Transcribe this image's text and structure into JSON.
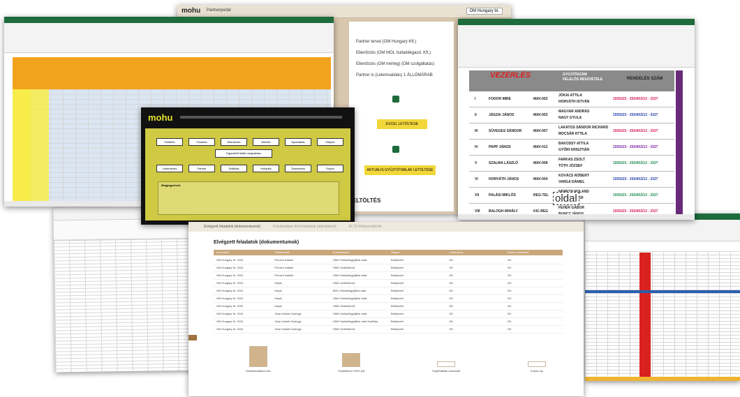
{
  "portal": {
    "logo": "mohu",
    "title": "Partnerportál",
    "user_chip": "OM Hungary bt.",
    "side_list": [
      "Partner tervei (OM Hungary Kft.)",
      "Ellenőrzés (OM MOL hulladékgazd. Kft.)",
      "Ellenőrzés (OM mérleg) (OM szolgáltatás)",
      "Partner is (Lelemvalidás) 1 ÁLLÓMÁRAB"
    ],
    "btn1": "EXCEL LETÖLTÉSE",
    "btn2": "AKTUÁLIS GYŰJTŐTÁBLÁK LETÖLTÉSE",
    "upload_label": "FELTÖLTÉS"
  },
  "excel_right": {
    "title": "VEZÉRLÉS",
    "col_header": "GYŰJTŐSZÁM",
    "col_header2": "FELELŐS RÉSZVÉTELE",
    "col_header3": "RENDELÉS SZÁM",
    "rows": [
      {
        "n": "I",
        "name": "FODOR IMRE",
        "code": "MAV-002",
        "p1": "JÓKAI ATTILA",
        "p2": "HORVÁTH ISTVÁN",
        "ord": "1930223 - 2024/02/13 - 3327",
        "color": "#d4145a"
      },
      {
        "n": "II",
        "name": "JÁSZAI JÁNOS",
        "code": "MAV-003",
        "p1": "MAGYAR ANDRÁS",
        "p2": "NAGY GYULA",
        "ord": "1930223 - 2024/02/13 - 3327",
        "color": "#1f3ba8"
      },
      {
        "n": "III",
        "name": "SÜVEGES SÁNDOR",
        "code": "MAV-007",
        "p1": "LAKATOS SÁNDOR RICHÁRD",
        "p2": "MOCSÁR ATTILA",
        "ord": "1930223 - 2024/02/13 - 3327",
        "color": "#d4145a"
      },
      {
        "n": "IV",
        "name": "PAPP JÁNOS",
        "code": "MAV-012",
        "p1": "BAKOSSY ATTILA",
        "p2": "GYŐRI KRISZTIÁN",
        "ord": "1930223 - 2024/02/13 - 3327",
        "color": "#7a1fa8"
      },
      {
        "n": "V",
        "name": "SZALMA LÁSZLÓ",
        "code": "MAV-008",
        "p1": "FARKAS ZSOLT",
        "p2": "TÓTH JÓZSEF",
        "ord": "1930223 - 2024/02/13 - 3327",
        "color": "#178a4a"
      },
      {
        "n": "VI",
        "name": "HORVÁTH JÁNOS",
        "code": "MAV-004",
        "p1": "KOVÁCS RÓBERT",
        "p2": "VARGA DÁNIEL",
        "ord": "1930223 - 2024/02/13 - 3327",
        "color": "#1f3ba8"
      },
      {
        "n": "VII",
        "name": "PALÁSI MIKLÓS",
        "code": "REG-TEL",
        "p1": "NÉMETH ROLAND",
        "p2": "SZABÓ PÉTER",
        "ord": "1930223 - 2024/02/13 - 3327",
        "color": "#178a4a"
      },
      {
        "n": "VIII",
        "name": "BALOGH MIHÁLY",
        "code": "KIC-REG",
        "p1": "FEHÉR GÁBOR",
        "p2": "BUNCZ JÁNOS",
        "ord": "1930223 - 2024/02/13 - 3327",
        "color": "#d4145a"
      }
    ],
    "page_label": "oldal"
  },
  "mohu_dialog": {
    "logo": "mohu",
    "buttons_row1": [
      "Feltöltés",
      "Frissítés",
      "Ellenőrzés",
      "Mentés",
      "Nyomtatás",
      "Kilépés"
    ],
    "mid_label": "Egyesített listák megnyitása",
    "buttons_row2": [
      "Lekérdezés",
      "Partner",
      "Szállítás",
      "Hulladék",
      "Összesítés",
      "Export"
    ],
    "notes_title": "Megjegyzések:"
  },
  "tasks": {
    "tabs": [
      "Elvégzett feladatok (dokumentumok)",
      "Folyamatban lévő feladatok (aktiválások)",
      "ELTE felhasználói fel"
    ],
    "heading": "Elvégzett feladatok (dokumentumok)",
    "columns": [
      "Azonosító",
      "Felhasználó",
      "Dokumentum",
      "Állapot",
      "Létrehozva",
      "Utolsó módosítás"
    ],
    "rows": [
      [
        "OM Hungary bt. 2024",
        "Pénzes Katalin",
        "OMD Hulladékgyűjtési adat",
        "Befejezett",
        "OK",
        "OK"
      ],
      [
        "OM Hungary bt. 2024",
        "Pénzes Katalin",
        "OMD Szállítólevél",
        "Befejezett",
        "OK",
        "OK"
      ],
      [
        "OM Hungary bt. 2024",
        "Pénzes Katalin",
        "OMD Hulladékgyűjtési adat",
        "Befejezett",
        "OK",
        "OK"
      ],
      [
        "OM Hungary bt. 2024",
        "Hajdú",
        "OMD Szállítólevél",
        "Befejezett",
        "OK",
        "OK"
      ],
      [
        "OM Hungary bt. 2024",
        "Hajdú",
        "MOL Hulladékgyűjtési adat",
        "Befejezett",
        "OK",
        "OK"
      ],
      [
        "OM Hungary bt. 2024",
        "Hajdú",
        "OMD Hulladékgyűjtési adat",
        "Befejezett",
        "OK",
        "OK"
      ],
      [
        "OM Hungary bt. 2024",
        "Hajdú",
        "OMD Szállítólevél",
        "Befejezett",
        "OK",
        "OK"
      ],
      [
        "OM Hungary bt. 2024",
        "Szép Katalin Gyöngyi",
        "OMD Hulladékgyűjtési adat",
        "Befejezett",
        "OK",
        "OK"
      ],
      [
        "OM Hungary bt. 2024",
        "Szép Katalin Gyöngyi",
        "OMD Hulladékgyűjtési adat Szállítás",
        "Befejezett",
        "OK",
        "OK"
      ],
      [
        "OM Hungary bt. 2024",
        "Szép Katalin Gyöngyi",
        "OMD Szállítólevél",
        "Befejezett",
        "OK",
        "OK"
      ]
    ],
    "files": [
      "Hulladékadatok.xlsx",
      "Szállítólevél 2024.pdf",
      "Gyűjtőtáblák összesítő",
      "Export.zip"
    ]
  }
}
